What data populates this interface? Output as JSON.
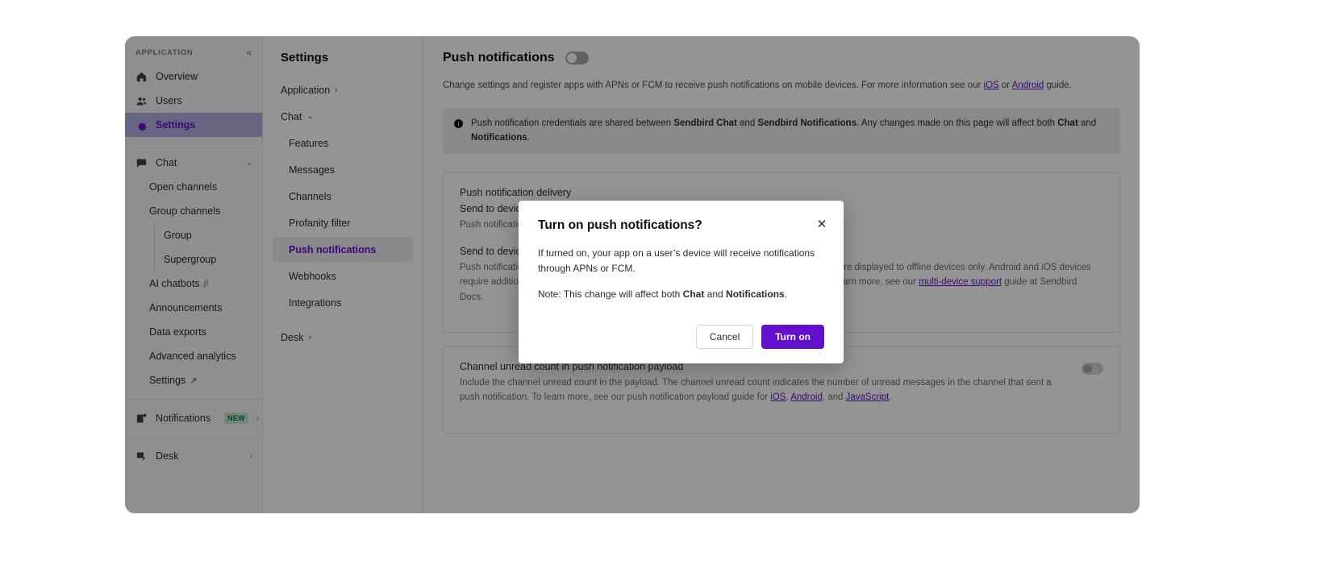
{
  "sidebar": {
    "section_label": "APPLICATION",
    "collapse_icon": "chevron-double-left",
    "top_items": [
      {
        "label": "Overview",
        "icon": "home-icon",
        "active": false
      },
      {
        "label": "Users",
        "icon": "users-icon",
        "active": false
      },
      {
        "label": "Settings",
        "icon": "gear-icon",
        "active": true
      }
    ],
    "chat_group": {
      "label": "Chat",
      "icon": "chat-icon",
      "caret": "⌄"
    },
    "chat_items": [
      {
        "label": "Open channels",
        "indent": false
      },
      {
        "label": "Group channels",
        "indent": false
      },
      {
        "label": "Group",
        "indent": true
      },
      {
        "label": "Supergroup",
        "indent": true
      },
      {
        "label": "AI chatbots",
        "indent": false,
        "beta": "β"
      },
      {
        "label": "Announcements",
        "indent": false
      },
      {
        "label": "Data exports",
        "indent": false
      },
      {
        "label": "Advanced analytics",
        "indent": false
      },
      {
        "label": "Settings",
        "indent": false,
        "external": "↗"
      }
    ],
    "bottom_items": [
      {
        "label": "Notifications",
        "icon": "notifications-icon",
        "badge": "NEW",
        "caret": "›"
      },
      {
        "label": "Desk",
        "icon": "desk-icon",
        "caret": "›"
      }
    ]
  },
  "settings_nav": {
    "title": "Settings",
    "items": [
      {
        "label": "Application",
        "chevron": "›",
        "type": "group"
      },
      {
        "label": "Chat",
        "chevron": "⌄",
        "type": "group-open"
      },
      {
        "label": "Features",
        "type": "sub"
      },
      {
        "label": "Messages",
        "type": "sub"
      },
      {
        "label": "Channels",
        "type": "sub"
      },
      {
        "label": "Profanity filter",
        "type": "sub"
      },
      {
        "label": "Push notifications",
        "type": "sub",
        "active": true
      },
      {
        "label": "Webhooks",
        "type": "sub"
      },
      {
        "label": "Integrations",
        "type": "sub"
      },
      {
        "label": "Desk",
        "chevron": "›",
        "type": "group"
      }
    ]
  },
  "main": {
    "title": "Push notifications",
    "toggle_on": false,
    "description_parts": {
      "p1": "Change settings and register apps with APNs or FCM to receive push notifications on mobile devices. For more information see our ",
      "link_ios": "iOS",
      "p2": " or ",
      "link_android": "Android",
      "p3": " guide."
    },
    "banner": {
      "icon": "info-icon",
      "p1": "Push notification credentials are shared between ",
      "b1": "Sendbird Chat",
      "p2": " and ",
      "b2": "Sendbird Notifications",
      "p3": ". Any changes made on this page will affect both ",
      "b3": "Chat",
      "p4": " and ",
      "b4": "Notifications",
      "p5": "."
    },
    "card1": {
      "heading": "Push notification delivery",
      "option1_title": "Send to devices when all offline",
      "option1_desc": "Push notifications are sent only when all devices are offline.",
      "option2_title": "Send to devices both offline and online",
      "option2_desc_1": "Push notifications are sent to all devices regardless of online status. By default, notifications are displayed to offline devices only. Android and iOS devices require additional implementation to send notifications to both offline and online devices. To learn more, see our ",
      "option2_link": "multi-device support",
      "option2_desc_2": " guide at Sendbird Docs."
    },
    "card2": {
      "title": "Channel unread count in push notification payload",
      "desc_1": "Include the channel unread count in the payload. The channel unread count indicates the number of unread messages in the channel that sent a push notification. To learn more, see our push notification payload guide for ",
      "link_ios": "iOS",
      "sep1": ", ",
      "link_android": "Android",
      "sep2": ", and ",
      "link_js": "JavaScript",
      "desc_2": "."
    }
  },
  "modal": {
    "title": "Turn on push notifications?",
    "close_icon": "close-icon",
    "paragraph1": "If turned on, your app on a user’s device will receive notifications through APNs or FCM.",
    "paragraph2_pre": "Note: This change will affect both ",
    "paragraph2_b1": "Chat",
    "paragraph2_mid": " and ",
    "paragraph2_b2": "Notifications",
    "paragraph2_post": ".",
    "cancel_label": "Cancel",
    "confirm_label": "Turn on"
  },
  "colors": {
    "accent": "#6210cc",
    "active_nav_bg": "#b4aee0",
    "badge_new_bg": "#c5e8d2"
  }
}
